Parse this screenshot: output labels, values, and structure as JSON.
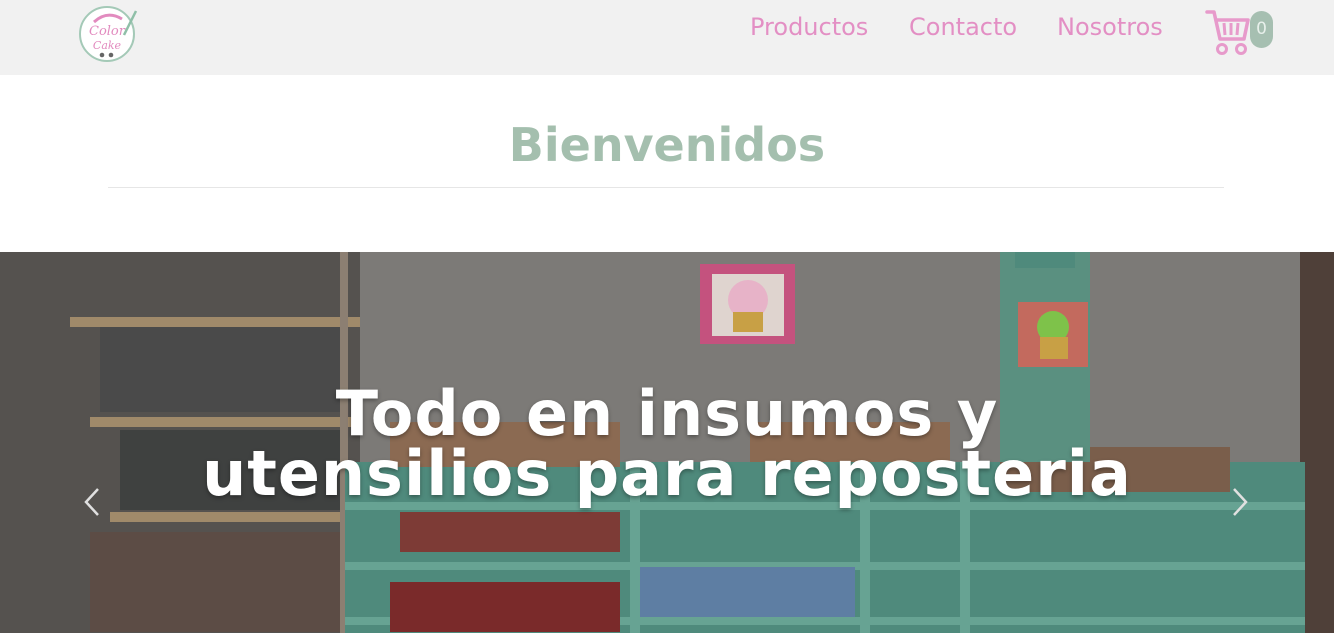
{
  "navbar": {
    "logo_alt": "Color Cake",
    "links": [
      {
        "label": "Productos"
      },
      {
        "label": "Contacto"
      },
      {
        "label": "Nosotros"
      }
    ],
    "cart": {
      "count": "0",
      "icon": "cart-icon"
    }
  },
  "welcome": {
    "title": "Bienvenidos"
  },
  "hero": {
    "caption": "Todo en insumos y utensilios para reposteria",
    "prev_icon": "chevron-left-icon",
    "next_icon": "chevron-right-icon"
  },
  "colors": {
    "nav_link": "#e38fc4",
    "title": "#a4bfae",
    "navbar_bg": "#f1f1f1",
    "badge_bg": "#a6bfb1"
  }
}
